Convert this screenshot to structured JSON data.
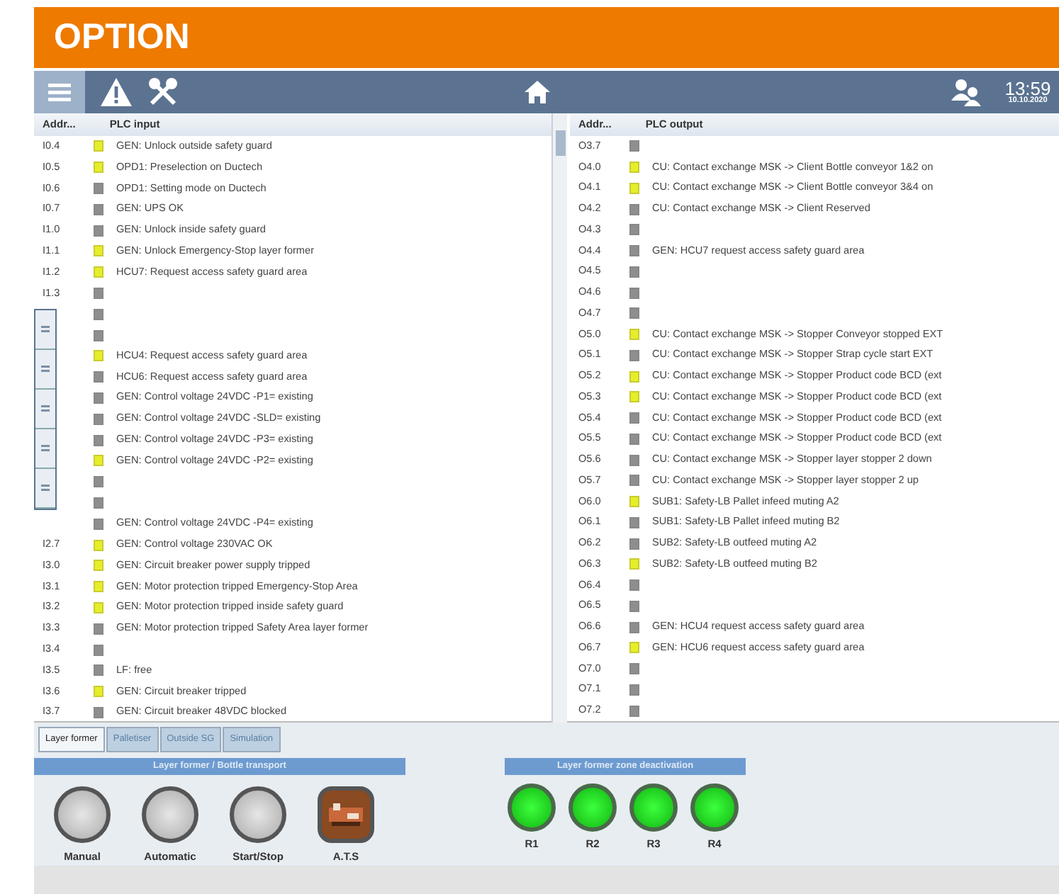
{
  "banner": {
    "title": "OPTION"
  },
  "toolbar": {
    "time": "13:59",
    "date": "10.10.2020"
  },
  "input_table": {
    "columns": [
      "Addr...",
      "PLC input"
    ],
    "rows": [
      {
        "address": "I0.4",
        "active": true,
        "text": "GEN: Unlock outside safety guard"
      },
      {
        "address": "I0.5",
        "active": true,
        "text": "OPD1: Preselection on Ductech"
      },
      {
        "address": "I0.6",
        "active": false,
        "text": "OPD1: Setting mode on Ductech"
      },
      {
        "address": "I0.7",
        "active": false,
        "text": "GEN: UPS OK"
      },
      {
        "address": "I1.0",
        "active": false,
        "text": "GEN: Unlock inside safety guard"
      },
      {
        "address": "I1.1",
        "active": true,
        "text": "GEN: Unlock Emergency-Stop layer former"
      },
      {
        "address": "I1.2",
        "active": true,
        "text": "HCU7: Request access safety guard area"
      },
      {
        "address": "I1.3",
        "active": false,
        "text": ""
      },
      {
        "address": "",
        "active": false,
        "text": ""
      },
      {
        "address": "",
        "active": false,
        "text": ""
      },
      {
        "address": "",
        "active": true,
        "text": "HCU4: Request access safety guard area"
      },
      {
        "address": "",
        "active": false,
        "text": "HCU6: Request access safety guard area"
      },
      {
        "address": "",
        "active": false,
        "text": "GEN: Control voltage 24VDC -P1= existing"
      },
      {
        "address": "",
        "active": false,
        "text": "GEN: Control voltage 24VDC -SLD= existing"
      },
      {
        "address": "",
        "active": false,
        "text": "GEN: Control voltage 24VDC -P3= existing"
      },
      {
        "address": "",
        "active": true,
        "text": "GEN: Control voltage 24VDC -P2= existing"
      },
      {
        "address": "",
        "active": false,
        "text": ""
      },
      {
        "address": "",
        "active": false,
        "text": ""
      },
      {
        "address": "",
        "active": false,
        "text": "GEN: Control voltage 24VDC -P4= existing"
      },
      {
        "address": "I2.7",
        "active": true,
        "text": "GEN: Control voltage 230VAC OK"
      },
      {
        "address": "I3.0",
        "active": true,
        "text": "GEN: Circuit breaker power supply tripped"
      },
      {
        "address": "I3.1",
        "active": true,
        "text": "GEN: Motor protection tripped Emergency-Stop Area"
      },
      {
        "address": "I3.2",
        "active": true,
        "text": "GEN: Motor protection tripped inside safety guard"
      },
      {
        "address": "I3.3",
        "active": false,
        "text": "GEN: Motor protection tripped Safety Area layer former"
      },
      {
        "address": "I3.4",
        "active": false,
        "text": ""
      },
      {
        "address": "I3.5",
        "active": false,
        "text": "LF: free"
      },
      {
        "address": "I3.6",
        "active": true,
        "text": "GEN: Circuit breaker tripped"
      },
      {
        "address": "I3.7",
        "active": false,
        "text": "GEN: Circuit breaker 48VDC blocked"
      }
    ]
  },
  "output_table": {
    "columns": [
      "Addr...",
      "PLC output"
    ],
    "rows": [
      {
        "address": "O3.7",
        "active": false,
        "text": ""
      },
      {
        "address": "O4.0",
        "active": true,
        "text": "CU: Contact exchange MSK -> Client Bottle conveyor 1&2 on"
      },
      {
        "address": "O4.1",
        "active": true,
        "text": "CU: Contact exchange MSK -> Client Bottle conveyor 3&4 on"
      },
      {
        "address": "O4.2",
        "active": false,
        "text": "CU: Contact exchange MSK -> Client Reserved"
      },
      {
        "address": "O4.3",
        "active": false,
        "text": ""
      },
      {
        "address": "O4.4",
        "active": false,
        "text": "GEN: HCU7 request access safety guard area"
      },
      {
        "address": "O4.5",
        "active": false,
        "text": ""
      },
      {
        "address": "O4.6",
        "active": false,
        "text": ""
      },
      {
        "address": "O4.7",
        "active": false,
        "text": ""
      },
      {
        "address": "O5.0",
        "active": true,
        "text": "CU: Contact exchange MSK -> Stopper Conveyor stopped EXT"
      },
      {
        "address": "O5.1",
        "active": false,
        "text": "CU: Contact exchange MSK -> Stopper Strap cycle start EXT"
      },
      {
        "address": "O5.2",
        "active": true,
        "text": "CU: Contact exchange MSK -> Stopper Product code BCD (ext"
      },
      {
        "address": "O5.3",
        "active": true,
        "text": "CU: Contact exchange MSK -> Stopper Product code BCD (ext"
      },
      {
        "address": "O5.4",
        "active": false,
        "text": "CU: Contact exchange MSK -> Stopper Product code BCD (ext"
      },
      {
        "address": "O5.5",
        "active": false,
        "text": "CU: Contact exchange MSK -> Stopper Product code BCD (ext"
      },
      {
        "address": "O5.6",
        "active": false,
        "text": "CU: Contact exchange MSK -> Stopper layer stopper 2 down"
      },
      {
        "address": "O5.7",
        "active": false,
        "text": "CU: Contact exchange MSK -> Stopper layer stopper 2 up"
      },
      {
        "address": "O6.0",
        "active": true,
        "text": "SUB1: Safety-LB Pallet infeed muting A2"
      },
      {
        "address": "O6.1",
        "active": false,
        "text": "SUB1: Safety-LB Pallet infeed muting B2"
      },
      {
        "address": "O6.2",
        "active": false,
        "text": "SUB2: Safety-LB outfeed muting A2"
      },
      {
        "address": "O6.3",
        "active": true,
        "text": "SUB2: Safety-LB outfeed muting B2"
      },
      {
        "address": "O6.4",
        "active": false,
        "text": ""
      },
      {
        "address": "O6.5",
        "active": false,
        "text": ""
      },
      {
        "address": "O6.6",
        "active": false,
        "text": "GEN: HCU4 request access safety guard area"
      },
      {
        "address": "O6.7",
        "active": true,
        "text": "GEN: HCU6 request access safety guard area"
      },
      {
        "address": "O7.0",
        "active": false,
        "text": ""
      },
      {
        "address": "O7.1",
        "active": false,
        "text": ""
      },
      {
        "address": "O7.2",
        "active": false,
        "text": ""
      }
    ]
  },
  "tabs": [
    {
      "label": "Layer former",
      "selected": true
    },
    {
      "label": "Palletiser",
      "selected": false
    },
    {
      "label": "Outside SG",
      "selected": false
    },
    {
      "label": "Simulation",
      "selected": false
    }
  ],
  "transport": {
    "title": "Layer former / Bottle transport",
    "buttons": [
      {
        "kind": "round",
        "label": "Manual"
      },
      {
        "kind": "round",
        "label": "Automatic"
      },
      {
        "kind": "round",
        "label": "Start/Stop"
      },
      {
        "kind": "picture",
        "label": "A.T.S"
      }
    ]
  },
  "zones": {
    "title": "Layer former zone deactivation",
    "lamps": [
      {
        "label": "R1",
        "on": true
      },
      {
        "label": "R2",
        "on": true
      },
      {
        "label": "R3",
        "on": true
      },
      {
        "label": "R4",
        "on": true
      }
    ]
  }
}
